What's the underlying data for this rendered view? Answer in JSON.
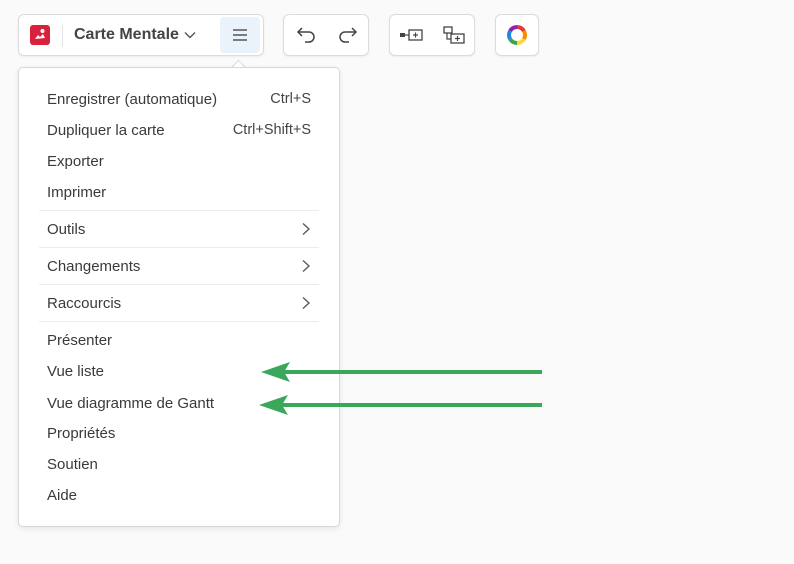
{
  "toolbar": {
    "title": "Carte Mentale",
    "title_dropdown_icon": "chevron-down-icon",
    "menu_icon": "hamburger-menu-icon",
    "undo_icon": "undo-icon",
    "redo_icon": "redo-icon",
    "add_sibling_icon": "add-sibling-node-icon",
    "add_child_icon": "add-child-node-icon",
    "color_icon": "color-wheel-icon",
    "logo_icon": "app-logo-icon"
  },
  "menu": {
    "group1": [
      {
        "label": "Enregistrer (automatique)",
        "shortcut": "Ctrl+S"
      },
      {
        "label": "Dupliquer la carte",
        "shortcut": "Ctrl+Shift+S"
      },
      {
        "label": "Exporter",
        "shortcut": ""
      },
      {
        "label": "Imprimer",
        "shortcut": ""
      }
    ],
    "submenus": [
      {
        "label": "Outils"
      },
      {
        "label": "Changements"
      },
      {
        "label": "Raccourcis"
      }
    ],
    "group3": [
      {
        "label": "Présenter"
      },
      {
        "label": "Vue liste"
      },
      {
        "label": "Vue diagramme de Gantt"
      },
      {
        "label": "Propriétés"
      },
      {
        "label": "Soutien"
      },
      {
        "label": "Aide"
      }
    ]
  },
  "colors": {
    "accent": "#d8213a",
    "arrow": "#3aa75a",
    "menu_active_bg": "#eaf2fb"
  }
}
